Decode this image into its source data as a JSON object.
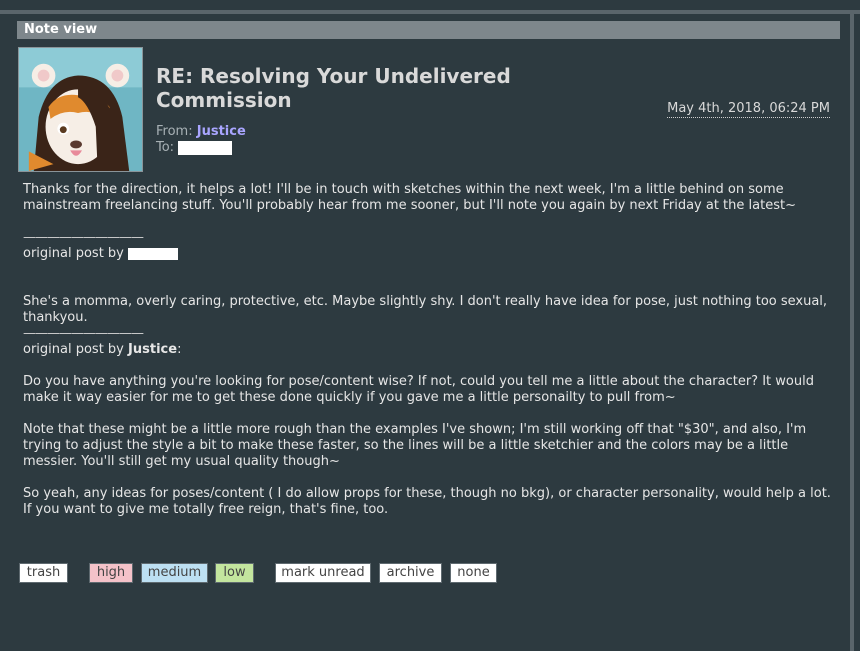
{
  "section_title": "Note view",
  "note": {
    "title_line1": "RE: Resolving Your Undelivered",
    "title_line2": "Commission",
    "date": "May 4th, 2018, 06:24 PM",
    "from_label": "From:",
    "from_user": "Justice",
    "to_label": "To:"
  },
  "body": {
    "p1": "Thanks for the direction, it helps a lot! I'll be in touch with sketches within the next week, I'm a little behind on some mainstream freelancing stuff. You'll probably hear from me sooner, but I'll note you again by next Friday at the latest~",
    "divider": "——————————",
    "orig1_prefix": "original post by",
    "p2": "She's a momma, overly caring, protective, etc. Maybe slightly shy. I don't really have idea for pose, just nothing too sexual, thankyou.",
    "orig2_prefix": "original post by",
    "orig2_user": "Justice",
    "orig2_suffix": ":",
    "p3": "Do you have anything you're looking for pose/content wise? If not, could you tell me a little about the character? It would make it way easier for me to get these done quickly if you gave me a little personailty to pull from~",
    "p4": "Note that these might be a little more rough than the examples I've shown; I'm still working off that \"$30\", and also, I'm trying to adjust the style a bit to make these faster, so the lines will be a little sketchier and the colors may be a little messier. You'll still get my usual quality though~",
    "p5": "So yeah, any ideas for poses/content ( I do allow props for these, though no bkg), or character personality, would help a lot. If you want to give me totally free reign, that's fine, too."
  },
  "buttons": {
    "trash": "trash",
    "high": "high",
    "medium": "medium",
    "low": "low",
    "mark_unread": "mark unread",
    "archive": "archive",
    "none": "none"
  },
  "colors": {
    "background": "#2d3a40",
    "header_bar": "#7e878c",
    "link": "#a9a5ff",
    "high": "#f4c2c9",
    "medium": "#bde0f3",
    "low": "#c3e59e"
  }
}
